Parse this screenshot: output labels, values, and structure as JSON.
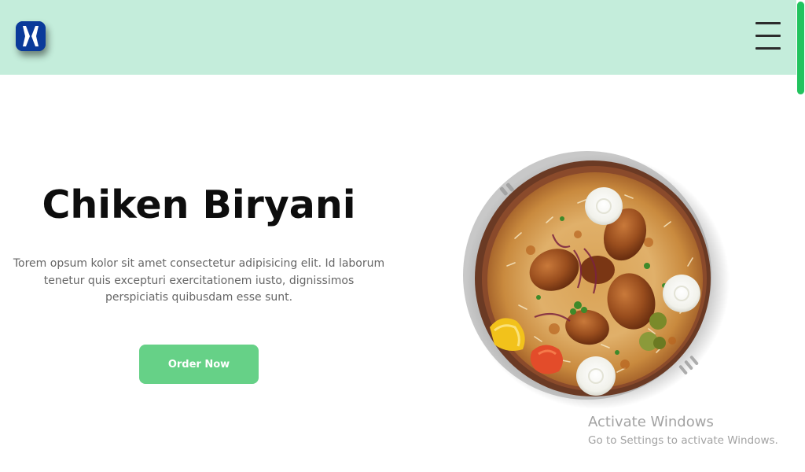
{
  "header": {
    "logo_icon": "hourglass-logo-icon",
    "menu_icon": "hamburger-menu-icon",
    "background": "#c4eddb"
  },
  "hero": {
    "title": "Chiken Biryani",
    "description": "Torem opsum kolor sit amet consectetur adipisicing elit. Id laborum tenetur quis excepturi exercitationem iusto, dignissimos perspiciatis quibusdam esse sunt.",
    "button_label": "Order Now",
    "button_color": "#66d187",
    "image": "biryani-plate-image"
  },
  "scrollbar": {
    "thumb_color": "#22c35e"
  },
  "watermark": {
    "title": "Activate Windows",
    "subtitle": "Go to Settings to activate Windows."
  }
}
